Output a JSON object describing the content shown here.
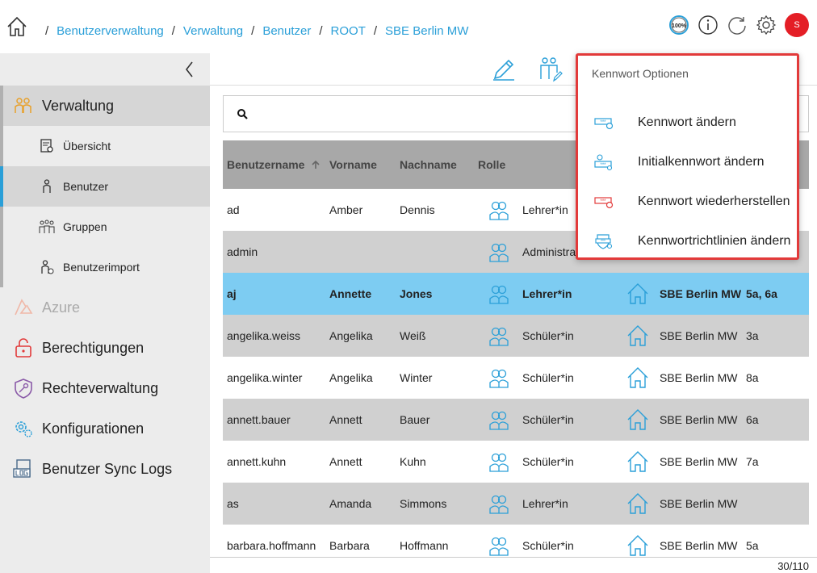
{
  "breadcrumb": [
    "Benutzerverwaltung",
    "Verwaltung",
    "Benutzer",
    "ROOT",
    "SBE Berlin MW"
  ],
  "header": {
    "zoom": "100%",
    "avatar_initial": "S"
  },
  "sidebar": {
    "items": [
      {
        "label": "Verwaltung",
        "icon": "admin-users-icon"
      },
      {
        "label": "Azure",
        "icon": "azure-icon"
      },
      {
        "label": "Berechtigungen",
        "icon": "lock-icon"
      },
      {
        "label": "Rechteverwaltung",
        "icon": "shield-key-icon"
      },
      {
        "label": "Konfigurationen",
        "icon": "gears-icon"
      },
      {
        "label": "Benutzer Sync Logs",
        "icon": "log-icon"
      }
    ],
    "subitems": [
      {
        "label": "Übersicht",
        "icon": "overview-icon"
      },
      {
        "label": "Benutzer",
        "icon": "user-icon"
      },
      {
        "label": "Gruppen",
        "icon": "group-icon"
      },
      {
        "label": "Benutzerimport",
        "icon": "import-icon"
      }
    ]
  },
  "search": {
    "value": "",
    "placeholder": ""
  },
  "table": {
    "columns": [
      "Benutzername",
      "Vorname",
      "Nachname",
      "Rolle"
    ],
    "rows": [
      {
        "username": "ad",
        "first": "Amber",
        "last": "Dennis",
        "role": "Lehrer*in",
        "school": "",
        "class": ""
      },
      {
        "username": "admin",
        "first": "",
        "last": "",
        "role": "Administra",
        "school": "",
        "class": ""
      },
      {
        "username": "aj",
        "first": "Annette",
        "last": "Jones",
        "role": "Lehrer*in",
        "school": "SBE Berlin MW",
        "class": "5a, 6a"
      },
      {
        "username": "angelika.weiss",
        "first": "Angelika",
        "last": "Weiß",
        "role": "Schüler*in",
        "school": "SBE Berlin MW",
        "class": "3a"
      },
      {
        "username": "angelika.winter",
        "first": "Angelika",
        "last": "Winter",
        "role": "Schüler*in",
        "school": "SBE Berlin MW",
        "class": "8a"
      },
      {
        "username": "annett.bauer",
        "first": "Annett",
        "last": "Bauer",
        "role": "Schüler*in",
        "school": "SBE Berlin MW",
        "class": "6a"
      },
      {
        "username": "annett.kuhn",
        "first": "Annett",
        "last": "Kuhn",
        "role": "Schüler*in",
        "school": "SBE Berlin MW",
        "class": "7a"
      },
      {
        "username": "as",
        "first": "Amanda",
        "last": "Simmons",
        "role": "Lehrer*in",
        "school": "SBE Berlin MW",
        "class": ""
      },
      {
        "username": "barbara.hoffmann",
        "first": "Barbara",
        "last": "Hoffmann",
        "role": "Schüler*in",
        "school": "SBE Berlin MW",
        "class": "5a"
      }
    ]
  },
  "footer": {
    "count": "30/110"
  },
  "dropdown": {
    "title": "Kennwort Optionen",
    "items": [
      {
        "label": "Kennwort ändern",
        "icon": "password-change-icon"
      },
      {
        "label": "Initialkennwort ändern",
        "icon": "initial-password-icon"
      },
      {
        "label": "Kennwort wiederherstellen",
        "icon": "password-restore-icon"
      },
      {
        "label": "Kennwortrichtlinien ändern",
        "icon": "password-policy-icon"
      }
    ]
  },
  "colors": {
    "accent": "#2a9fd8",
    "selected_row": "#7dccf2",
    "alt_row": "#d0d0d0",
    "header_row": "#a8a8a8",
    "danger": "#e23a3a",
    "avatar": "#e41e26"
  }
}
